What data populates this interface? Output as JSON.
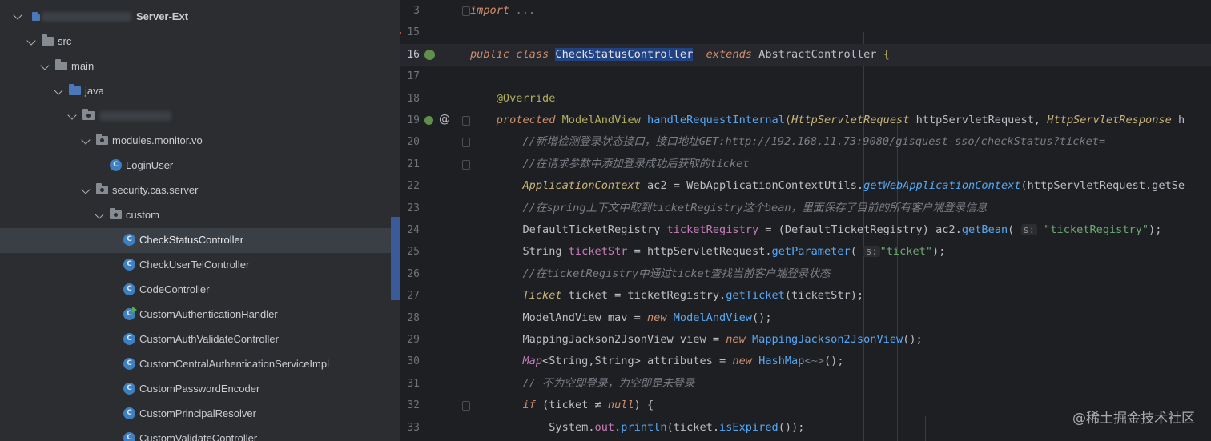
{
  "project_tree": {
    "root_label": "Server-Ext",
    "items": [
      {
        "label": "src"
      },
      {
        "label": "main"
      },
      {
        "label": "java"
      },
      {
        "label": "modules.monitor.vo"
      },
      {
        "label": "LoginUser"
      },
      {
        "label": "security.cas.server"
      },
      {
        "label": "custom"
      },
      {
        "label": "CheckStatusController"
      },
      {
        "label": "CheckUserTelController"
      },
      {
        "label": "CodeController"
      },
      {
        "label": "CustomAuthenticationHandler"
      },
      {
        "label": "CustomAuthValidateController"
      },
      {
        "label": "CustomCentralAuthenticationServiceImpl"
      },
      {
        "label": "CustomPasswordEncoder"
      },
      {
        "label": "CustomPrincipalResolver"
      },
      {
        "label": "CustomValidateController"
      }
    ],
    "class_icon_letter": "C"
  },
  "editor": {
    "line_numbers": [
      "3",
      "15",
      "16",
      "17",
      "18",
      "19",
      "20",
      "21",
      "22",
      "23",
      "24",
      "25",
      "26",
      "27",
      "28",
      "29",
      "30",
      "31",
      "32",
      "33"
    ],
    "current_line": "16",
    "gutter_at_symbol": "@",
    "tokens": {
      "import": "import",
      "import_dots": "...",
      "public": "public",
      "class": "class",
      "class_name": "CheckStatusController",
      "extends": "extends",
      "super_class": "AbstractController",
      "brace_open": "{",
      "override": "@Override",
      "protected": "protected",
      "mav_type": "ModelAndView",
      "method_name": "handleRequestInternal",
      "paren_open": "(",
      "req_type": "HttpServletRequest",
      "req_name": "httpServletRequest,",
      "resp_type": "HttpServletResponse",
      "resp_rest": "h",
      "cmt20_a": "//新增检测登录状态接口，接口地址GET:",
      "cmt20_url": "http://192.168.11.73:9080/gisquest-sso/checkStatus?ticket=",
      "cmt21": "//在请求参数中添加登录成功后获取的ticket",
      "l22_type": "ApplicationContext",
      "l22_a": " ac2 = WebApplicationContextUtils.",
      "l22_m": "getWebApplicationContext",
      "l22_b": "(httpServletRequest.getSe",
      "cmt23": "//在spring上下文中取到ticketRegistry这个bean，里面保存了目前的所有客户端登录信息",
      "l24_a": "DefaultTicketRegistry ",
      "l24_b": "ticketRegistry",
      "l24_c": " = (DefaultTicketRegistry) ac2.",
      "l24_m": "getBean",
      "l24_p": "(",
      "hint_s": "s:",
      "l24_str": "\"ticketRegistry\"",
      "l24_end": ");",
      "l25_a": "String ",
      "l25_b": "ticketStr",
      "l25_c": " = httpServletRequest.",
      "l25_m": "getParameter",
      "l25_p": "(",
      "l25_str": "\"ticket\"",
      "l25_end": ");",
      "cmt26": "//在ticketRegistry中通过ticket查找当前客户端登录状态",
      "l27_t": "Ticket",
      "l27_a": " ticket = ticketRegistry.",
      "l27_m": "getTicket",
      "l27_b": "(ticketStr);",
      "l28_a": "ModelAndView mav = ",
      "l28_new": "new",
      "l28_t": " ModelAndView",
      "l28_b": "();",
      "l29_a": "MappingJackson2JsonView view = ",
      "l29_new": "new",
      "l29_t": " MappingJackson2JsonView",
      "l29_b": "();",
      "l30_t": "Map",
      "l30_a": "<String,String> attributes = ",
      "l30_new": "new",
      "l30_c": " HashMap",
      "l30_d": "<~>",
      "l30_b": "();",
      "cmt31": "// 不为空即登录，为空即是未登录",
      "l32_if": "if",
      "l32_a": " (ticket ≠ ",
      "l32_null": "null",
      "l32_b": ") {",
      "l33_a": "System.",
      "l33_out": "out",
      "l33_b": ".",
      "l33_m": "println",
      "l33_c": "(ticket.",
      "l33_m2": "isExpired",
      "l33_d": "());"
    }
  },
  "watermark": "@稀土掘金技术社区",
  "colors": {
    "sidebar_bg": "#2b2d30",
    "editor_bg": "#1e1f22",
    "keyword": "#cf8e6d",
    "method": "#56a8f5",
    "string": "#6aab73",
    "comment": "#7a7e85",
    "annotation": "#b3ae60",
    "selection": "#214283"
  }
}
